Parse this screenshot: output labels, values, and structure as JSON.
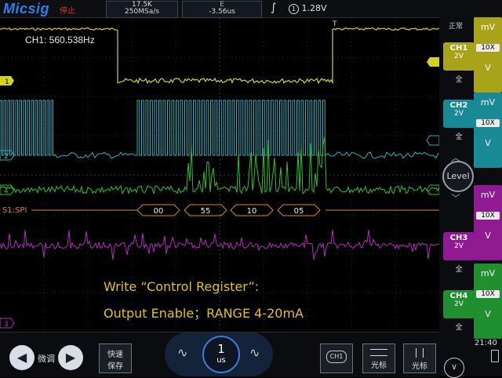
{
  "header": {
    "brand": "Micsig",
    "run_state": "停止",
    "sample_count": "17.5K",
    "sample_rate": "250MSa/s",
    "delay_marker": "E",
    "delay": "-3.56us",
    "trigger_slope_icon": "rising-edge-icon",
    "trigger_source_icon": "ch1-circle-icon",
    "trigger_level": "1.28V"
  },
  "measurement": {
    "label": "CH1: 560.538Hz"
  },
  "decode": {
    "label": "S1:SPI",
    "bytes": [
      "00",
      "55",
      "10",
      "05"
    ]
  },
  "annotation": {
    "line1": "Write “Control Register”:",
    "line2": "Output Enable；RANGE 4-20mA"
  },
  "channel_markers": [
    "1",
    "2",
    "4",
    "3"
  ],
  "right_panel": {
    "mode": "正常",
    "level_label": "Level",
    "clock": "21:40",
    "channels": [
      {
        "name": "CH1",
        "scale": "2V",
        "coupling": "全",
        "unit_top": "mV",
        "probe": "10X",
        "unit_bottom": "V",
        "color": "#c9c21a"
      },
      {
        "name": "CH2",
        "scale": "2V",
        "coupling": "全",
        "unit_top": "mV",
        "probe": "10X",
        "unit_bottom": "V",
        "color": "#1a9aa6"
      },
      {
        "name": "CH3",
        "scale": "2V",
        "coupling": "全",
        "unit_top": "mV",
        "probe": "10X",
        "unit_bottom": "V",
        "color": "#a51ea6"
      },
      {
        "name": "CH4",
        "scale": "2V",
        "coupling": "全",
        "unit_top": "mV",
        "probe": "10X",
        "unit_bottom": "V",
        "color": "#23a33a"
      }
    ]
  },
  "toolbar": {
    "fine_label": "微调",
    "quick_save": [
      "快速",
      "保存"
    ],
    "timebase_value": "1",
    "timebase_unit": "us",
    "ch1_button": "CH1",
    "cursor_h_label": "光标",
    "cursor_v_label": "光标"
  },
  "colors": {
    "ch1": "#d6d21e",
    "ch2": "#2ab3c4",
    "ch3": "#b52bc0",
    "ch4": "#2fbf2f",
    "decode": "#d9892a",
    "annotation": "#e0c21a"
  }
}
